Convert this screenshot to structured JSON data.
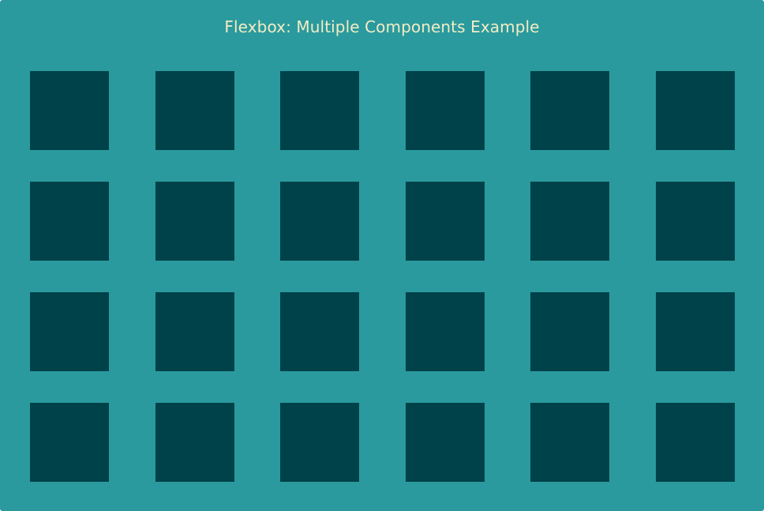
{
  "window": {
    "title": "Flexbox: Multiple Components Example"
  },
  "colors": {
    "background": "#2a9a9e",
    "box": "#00424a",
    "title_text": "#f3ecc4"
  },
  "grid": {
    "rows": 4,
    "columns": 6
  }
}
